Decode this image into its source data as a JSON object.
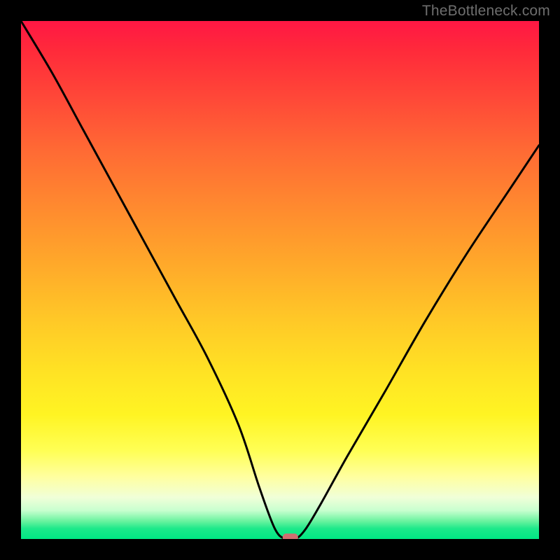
{
  "watermark": "TheBottleneck.com",
  "chart_data": {
    "type": "line",
    "title": "",
    "xlabel": "",
    "ylabel": "",
    "xlim": [
      0,
      100
    ],
    "ylim": [
      0,
      100
    ],
    "grid": false,
    "series": [
      {
        "name": "bottleneck-curve",
        "x": [
          0,
          6,
          12,
          18,
          24,
          30,
          36,
          42,
          46,
          49,
          51,
          53,
          55,
          58,
          63,
          70,
          78,
          86,
          94,
          100
        ],
        "values": [
          100,
          90,
          79,
          68,
          57,
          46,
          35,
          22,
          10,
          2,
          0,
          0,
          2,
          7,
          16,
          28,
          42,
          55,
          67,
          76
        ]
      }
    ],
    "annotations": [
      {
        "name": "optimal-marker",
        "x": 52,
        "y": 0.3,
        "color": "#cf6e70",
        "shape": "pill"
      }
    ],
    "background_gradient": {
      "orientation": "vertical",
      "stops": [
        {
          "pos": 0.0,
          "color": "#ff1744"
        },
        {
          "pos": 0.25,
          "color": "#ff6a34"
        },
        {
          "pos": 0.5,
          "color": "#ffb828"
        },
        {
          "pos": 0.72,
          "color": "#fff123"
        },
        {
          "pos": 0.9,
          "color": "#ffffc0"
        },
        {
          "pos": 1.0,
          "color": "#00e884"
        }
      ]
    }
  }
}
